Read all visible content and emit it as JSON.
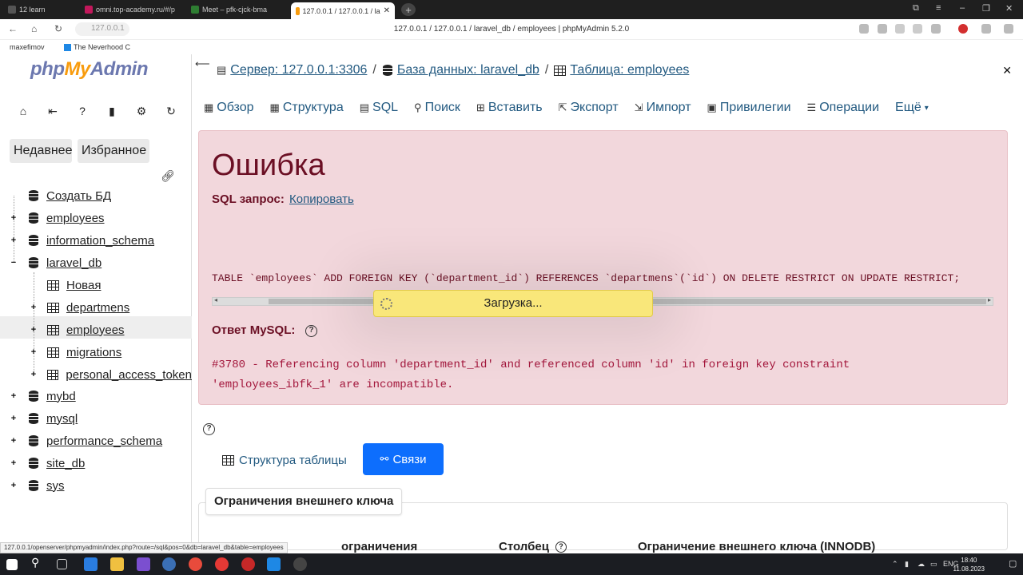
{
  "browser": {
    "tabs": [
      {
        "label": "12  learn",
        "active": false
      },
      {
        "label": "omni.top-academy.ru/#/p",
        "active": false
      },
      {
        "label": "Meet – pfk-cjck-bma",
        "active": false
      },
      {
        "label": "127.0.0.1 / 127.0.0.1 / la",
        "active": true
      }
    ],
    "address": "127.0.0.1",
    "page_title": "127.0.0.1 / 127.0.0.1 / laravel_db / employees | phpMyAdmin 5.2.0",
    "bookmarks": [
      "maxefimov",
      "The Neverhood C"
    ],
    "status_url": "127.0.0.1/openserver/phpmyadmin/index.php?route=/sql&pos=0&db=laravel_db&table=employees"
  },
  "sidebar": {
    "logo_php": "php",
    "logo_my": "My",
    "logo_admin": "Admin",
    "recent_label": "Недавнее",
    "favorites_label": "Избранное",
    "tree": [
      {
        "label": "Создать БД",
        "icon": "db-new-icon"
      },
      {
        "label": "employees",
        "icon": "db-icon"
      },
      {
        "label": "information_schema",
        "icon": "db-icon"
      },
      {
        "label": "laravel_db",
        "icon": "db-icon"
      },
      {
        "label": "Новая",
        "icon": "table-new-icon"
      },
      {
        "label": "departmens",
        "icon": "table-icon"
      },
      {
        "label": "employees",
        "icon": "table-icon"
      },
      {
        "label": "migrations",
        "icon": "table-icon"
      },
      {
        "label": "personal_access_token",
        "icon": "table-icon"
      },
      {
        "label": "mybd",
        "icon": "db-icon"
      },
      {
        "label": "mysql",
        "icon": "db-icon"
      },
      {
        "label": "performance_schema",
        "icon": "db-icon"
      },
      {
        "label": "site_db",
        "icon": "db-icon"
      },
      {
        "label": "sys",
        "icon": "db-icon"
      }
    ]
  },
  "breadcrumb": {
    "server": "Сервер: 127.0.0.1:3306",
    "database": "База данных: laravel_db",
    "table": "Таблица: employees"
  },
  "tabs": [
    "Обзор",
    "Структура",
    "SQL",
    "Поиск",
    "Вставить",
    "Экспорт",
    "Импорт",
    "Привилегии",
    "Операции",
    "Ещё"
  ],
  "error": {
    "title": "Ошибка",
    "sql_label": "SQL запрос:",
    "copy_link": "Копировать",
    "sql_text": "TABLE `employees` ADD  FOREIGN KEY (`department_id`) REFERENCES `departmens`(`id`) ON DELETE RESTRICT ON UPDATE RESTRICT;",
    "mysql_label": "Ответ MySQL:",
    "mysql_message_line1": "#3780 - Referencing column 'department_id' and referenced column 'id' in foreign key constraint",
    "mysql_message_line2": "'employees_ibfk_1' are incompatible."
  },
  "loading": "Загрузка...",
  "actions": {
    "structure": "Структура таблицы",
    "relations": "Связи"
  },
  "fk": {
    "legend": "Ограничения внешнего ключа",
    "col_constraint": "ограничения",
    "col_column": "Столбец",
    "col_fk": "Ограничение внешнего ключа (INNODB)"
  },
  "taskbar": {
    "lang": "ENG",
    "time": "18:40",
    "date": "11.08.2023"
  },
  "colors": {
    "error_bg": "#f2d7dc",
    "error_text": "#6b0f24",
    "link": "#235a81",
    "primary_button": "#0d6efd",
    "loading_bg": "#f9e77a"
  }
}
